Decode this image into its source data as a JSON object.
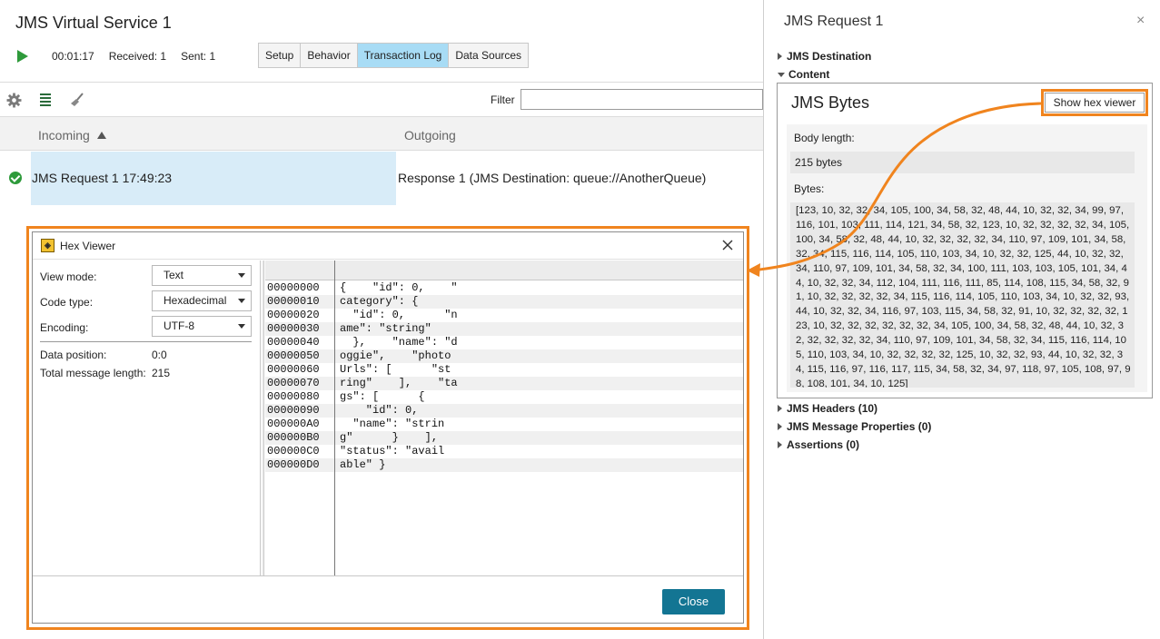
{
  "service": {
    "title": "JMS Virtual Service 1",
    "elapsed": "00:01:17",
    "received": "Received: 1",
    "sent": "Sent: 1",
    "tabs": [
      "Setup",
      "Behavior",
      "Transaction Log",
      "Data Sources"
    ],
    "active_tab": "Transaction Log"
  },
  "toolbar": {
    "icons": [
      "gear-icon",
      "list-icon",
      "broom-icon"
    ],
    "filter_label": "Filter",
    "filter_value": ""
  },
  "log": {
    "col_incoming": "Incoming",
    "col_outgoing": "Outgoing",
    "rows": [
      {
        "incoming": "JMS Request 1 17:49:23",
        "outgoing": "Response 1 (JMS Destination: queue://AnotherQueue)"
      }
    ]
  },
  "hex_viewer": {
    "title": "Hex Viewer",
    "view_mode_label": "View mode:",
    "view_mode_value": "Text",
    "code_type_label": "Code type:",
    "code_type_value": "Hexadecimal",
    "encoding_label": "Encoding:",
    "encoding_value": "UTF-8",
    "data_position_label": "Data position:",
    "data_position_value": "0:0",
    "total_length_label": "Total message length:",
    "total_length_value": "215",
    "rows": [
      {
        "offset": "00000000",
        "text": "{    \"id\": 0,    \""
      },
      {
        "offset": "00000010",
        "text": "category\": {"
      },
      {
        "offset": "00000020",
        "text": "  \"id\": 0,      \"n"
      },
      {
        "offset": "00000030",
        "text": "ame\": \"string\""
      },
      {
        "offset": "00000040",
        "text": "  },    \"name\": \"d"
      },
      {
        "offset": "00000050",
        "text": "oggie\",    \"photo"
      },
      {
        "offset": "00000060",
        "text": "Urls\": [      \"st"
      },
      {
        "offset": "00000070",
        "text": "ring\"    ],    \"ta"
      },
      {
        "offset": "00000080",
        "text": "gs\": [      {"
      },
      {
        "offset": "00000090",
        "text": "    \"id\": 0,"
      },
      {
        "offset": "000000A0",
        "text": "  \"name\": \"strin"
      },
      {
        "offset": "000000B0",
        "text": "g\"      }    ],"
      },
      {
        "offset": "000000C0",
        "text": "\"status\": \"avail"
      },
      {
        "offset": "000000D0",
        "text": "able\" }"
      }
    ],
    "close_label": "Close"
  },
  "request": {
    "title": "JMS Request 1",
    "close_glyph": "×",
    "node_destination": "JMS Destination",
    "node_content": "Content",
    "bytes_title": "JMS Bytes",
    "show_hex_label": "Show hex viewer",
    "body_length_label": "Body length:",
    "body_length_value": "215 bytes",
    "bytes_label": "Bytes:",
    "bytes_value": "[123, 10, 32, 32, 34, 105, 100, 34, 58, 32, 48, 44, 10, 32, 32, 34, 99, 97, 116, 101, 103, 111, 114, 121, 34, 58, 32, 123, 10, 32, 32, 32, 32, 34, 105, 100, 34, 58, 32, 48, 44, 10, 32, 32, 32, 32, 34, 110, 97, 109, 101, 34, 58, 32, 34, 115, 116, 114, 105, 110, 103, 34, 10, 32, 32, 125, 44, 10, 32, 32, 34, 110, 97, 109, 101, 34, 58, 32, 34, 100, 111, 103, 103, 105, 101, 34, 44, 10, 32, 32, 34, 112, 104, 111, 116, 111, 85, 114, 108, 115, 34, 58, 32, 91, 10, 32, 32, 32, 32, 34, 115, 116, 114, 105, 110, 103, 34, 10, 32, 32, 93, 44, 10, 32, 32, 34, 116, 97, 103, 115, 34, 58, 32, 91, 10, 32, 32, 32, 32, 123, 10, 32, 32, 32, 32, 32, 32, 34, 105, 100, 34, 58, 32, 48, 44, 10, 32, 32, 32, 32, 32, 32, 34, 110, 97, 109, 101, 34, 58, 32, 34, 115, 116, 114, 105, 110, 103, 34, 10, 32, 32, 32, 32, 125, 10, 32, 32, 93, 44, 10, 32, 32, 34, 115, 116, 97, 116, 117, 115, 34, 58, 32, 34, 97, 118, 97, 105, 108, 97, 98, 108, 101, 34, 10, 125]",
    "node_headers": "JMS Headers (10)",
    "node_props": "JMS Message Properties (0)",
    "node_assertions": "Assertions (0)"
  },
  "colors": {
    "highlight": "#f0841e",
    "active_tab": "#a8dcf5",
    "selected_row": "#d8ecf8",
    "close_button": "#137593",
    "status_ok": "#2e9a3b"
  }
}
